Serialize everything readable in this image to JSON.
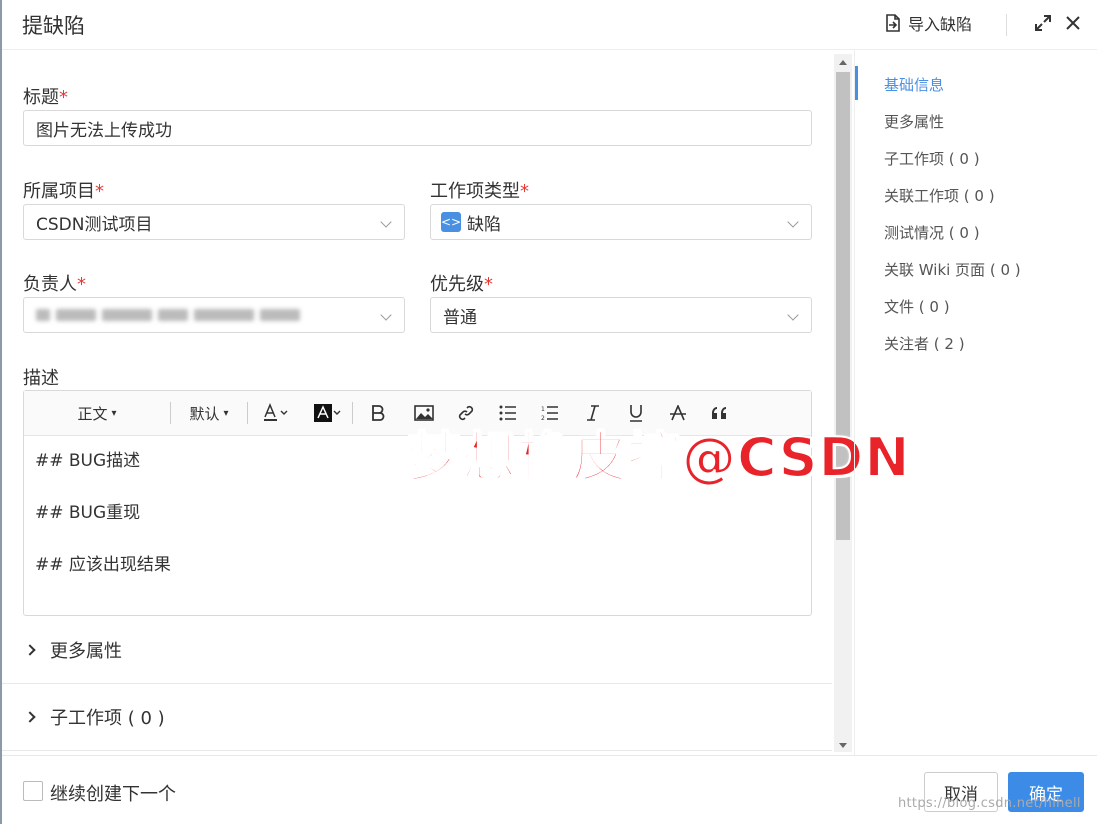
{
  "header": {
    "title": "提缺陷",
    "import_label": "导入缺陷"
  },
  "form": {
    "title_label": "标题",
    "title_value": "图片无法上传成功",
    "project_label": "所属项目",
    "project_value": "CSDN测试项目",
    "type_label": "工作项类型",
    "type_value": "缺陷",
    "assignee_label": "负责人",
    "priority_label": "优先级",
    "priority_value": "普通",
    "desc_label": "描述",
    "required_mark": "*"
  },
  "toolbar": {
    "paragraph": "正文",
    "font": "默认"
  },
  "editor": {
    "lines": [
      "## BUG描述",
      "## BUG重现",
      "## 应该出现结果"
    ]
  },
  "sections": {
    "more_attrs": "更多属性",
    "sub_items": "子工作项 ( 0 )"
  },
  "watermark": "梦想橡皮擦@CSDN",
  "right_nav": {
    "items": [
      {
        "label": "基础信息",
        "active": true
      },
      {
        "label": "更多属性"
      },
      {
        "label": "子工作项 ( 0 )"
      },
      {
        "label": "关联工作项 ( 0 )"
      },
      {
        "label": "测试情况 ( 0 )"
      },
      {
        "label": "关联 Wiki 页面 ( 0 )"
      },
      {
        "label": "文件 ( 0 )"
      },
      {
        "label": "关注者 ( 2 )"
      }
    ]
  },
  "footer": {
    "continue_label": "继续创建下一个",
    "cancel": "取消",
    "ok": "确定",
    "site_watermark": "https://blog.csdn.net/hihell"
  },
  "colors": {
    "accent": "#4a90e2",
    "primary_button": "#3c8ce7",
    "required": "#e53935",
    "watermark": "#e8232a"
  },
  "icons": {
    "import": "import-file-icon",
    "expand": "expand-icon",
    "close": "close-icon",
    "type": "code-bracket-icon"
  }
}
